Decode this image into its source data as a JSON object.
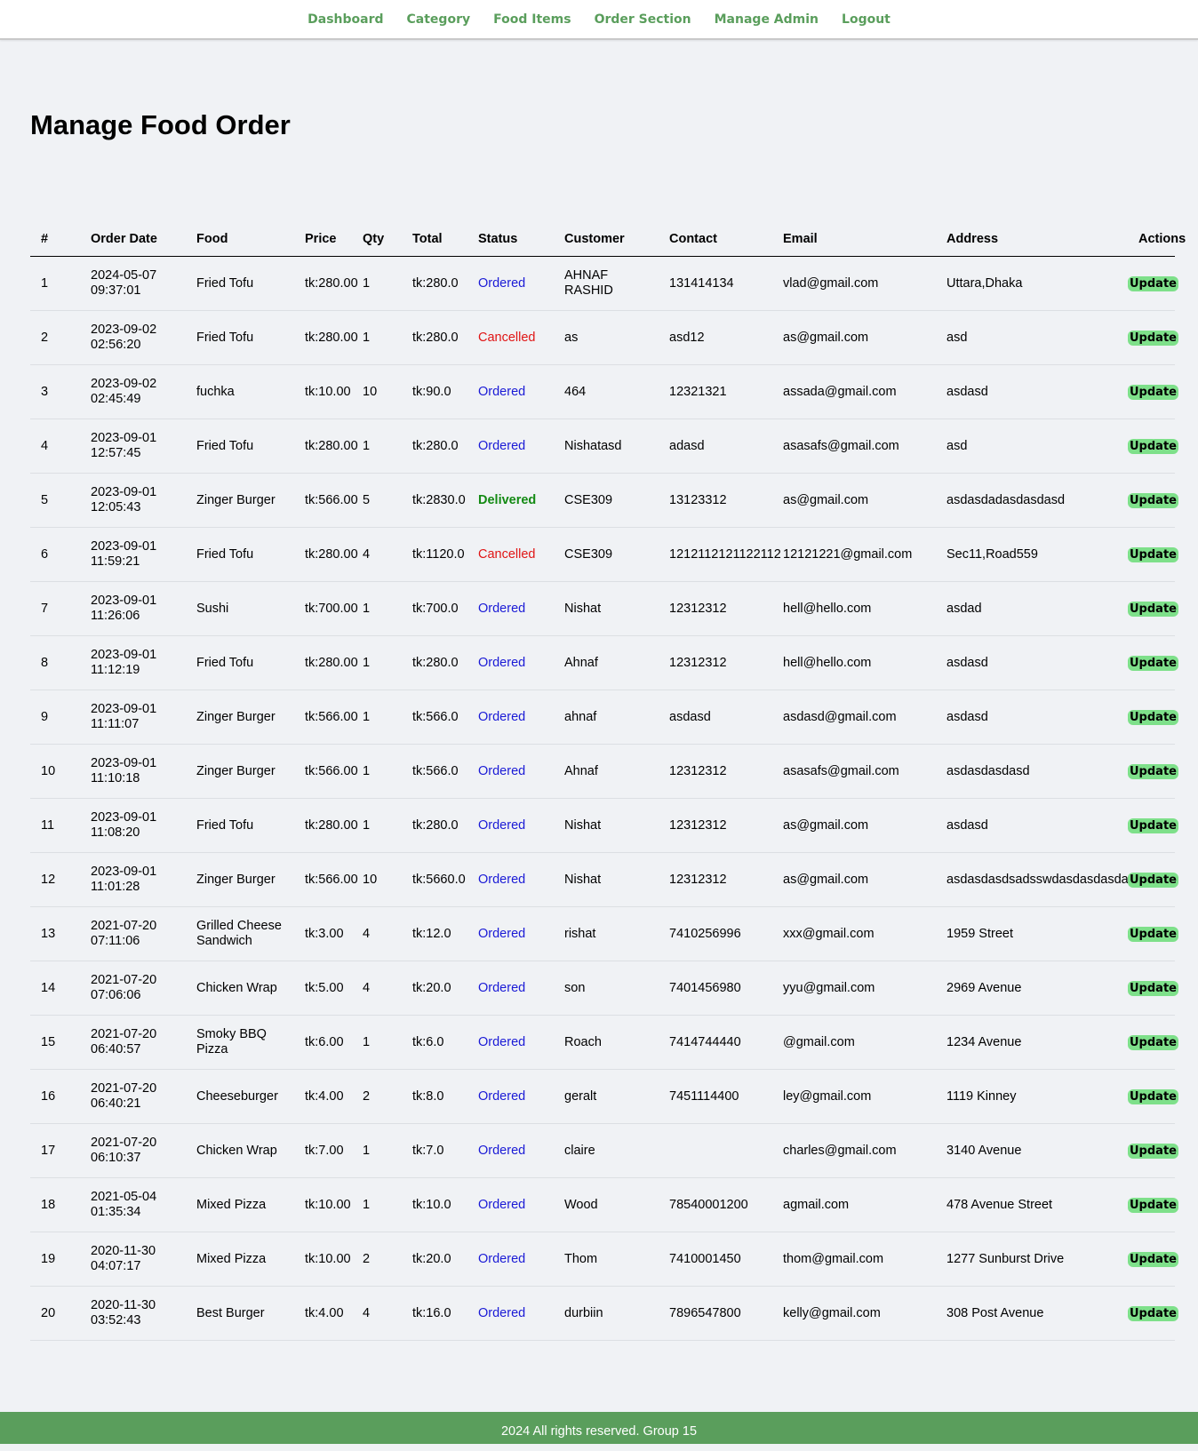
{
  "nav": {
    "items": [
      "Dashboard",
      "Category",
      "Food Items",
      "Order Section",
      "Manage Admin",
      "Logout"
    ]
  },
  "page": {
    "title": "Manage Food Order"
  },
  "table": {
    "headers": [
      "#",
      "Order Date",
      "Food",
      "Price",
      "Qty",
      "Total",
      "Status",
      "Customer",
      "Contact",
      "Email",
      "Address",
      "Actions"
    ],
    "action_label": "Update",
    "rows": [
      {
        "no": "1",
        "date": "2024-05-07",
        "time": "09:37:01",
        "food": "Fried Tofu",
        "price": "tk:280.00",
        "qty": "1",
        "total": "tk:280.0",
        "status": "Ordered",
        "customer": "AHNAF RASHID",
        "contact": "131414134",
        "email": "vlad@gmail.com",
        "address": "Uttara,Dhaka"
      },
      {
        "no": "2",
        "date": "2023-09-02",
        "time": "02:56:20",
        "food": "Fried Tofu",
        "price": "tk:280.00",
        "qty": "1",
        "total": "tk:280.0",
        "status": "Cancelled",
        "customer": "as",
        "contact": "asd12",
        "email": "as@gmail.com",
        "address": "asd"
      },
      {
        "no": "3",
        "date": "2023-09-02",
        "time": "02:45:49",
        "food": "fuchka",
        "price": "tk:10.00",
        "qty": "10",
        "total": "tk:90.0",
        "status": "Ordered",
        "customer": "464",
        "contact": "12321321",
        "email": "assada@gmail.com",
        "address": "asdasd"
      },
      {
        "no": "4",
        "date": "2023-09-01",
        "time": "12:57:45",
        "food": "Fried Tofu",
        "price": "tk:280.00",
        "qty": "1",
        "total": "tk:280.0",
        "status": "Ordered",
        "customer": "Nishatasd",
        "contact": "adasd",
        "email": "asasafs@gmail.com",
        "address": "asd"
      },
      {
        "no": "5",
        "date": "2023-09-01",
        "time": "12:05:43",
        "food": "Zinger Burger",
        "price": "tk:566.00",
        "qty": "5",
        "total": "tk:2830.0",
        "status": "Delivered",
        "customer": "CSE309",
        "contact": "13123312",
        "email": "as@gmail.com",
        "address": "asdasdadasdasdasd"
      },
      {
        "no": "6",
        "date": "2023-09-01",
        "time": "11:59:21",
        "food": "Fried Tofu",
        "price": "tk:280.00",
        "qty": "4",
        "total": "tk:1120.0",
        "status": "Cancelled",
        "customer": "CSE309",
        "contact": "1212112121122112",
        "email": "12121221@gmail.com",
        "address": "Sec11,Road559"
      },
      {
        "no": "7",
        "date": "2023-09-01",
        "time": "11:26:06",
        "food": "Sushi",
        "price": "tk:700.00",
        "qty": "1",
        "total": "tk:700.0",
        "status": "Ordered",
        "customer": "Nishat",
        "contact": "12312312",
        "email": "hell@hello.com",
        "address": "asdad"
      },
      {
        "no": "8",
        "date": "2023-09-01",
        "time": "11:12:19",
        "food": "Fried Tofu",
        "price": "tk:280.00",
        "qty": "1",
        "total": "tk:280.0",
        "status": "Ordered",
        "customer": "Ahnaf",
        "contact": "12312312",
        "email": "hell@hello.com",
        "address": "asdasd"
      },
      {
        "no": "9",
        "date": "2023-09-01",
        "time": "11:11:07",
        "food": "Zinger Burger",
        "price": "tk:566.00",
        "qty": "1",
        "total": "tk:566.0",
        "status": "Ordered",
        "customer": "ahnaf",
        "contact": "asdasd",
        "email": "asdasd@gmail.com",
        "address": "asdasd"
      },
      {
        "no": "10",
        "date": "2023-09-01",
        "time": "11:10:18",
        "food": "Zinger Burger",
        "price": "tk:566.00",
        "qty": "1",
        "total": "tk:566.0",
        "status": "Ordered",
        "customer": "Ahnaf",
        "contact": "12312312",
        "email": "asasafs@gmail.com",
        "address": "asdasdasdasd"
      },
      {
        "no": "11",
        "date": "2023-09-01",
        "time": "11:08:20",
        "food": "Fried Tofu",
        "price": "tk:280.00",
        "qty": "1",
        "total": "tk:280.0",
        "status": "Ordered",
        "customer": "Nishat",
        "contact": "12312312",
        "email": "as@gmail.com",
        "address": "asdasd"
      },
      {
        "no": "12",
        "date": "2023-09-01",
        "time": "11:01:28",
        "food": "Zinger Burger",
        "price": "tk:566.00",
        "qty": "10",
        "total": "tk:5660.0",
        "status": "Ordered",
        "customer": "Nishat",
        "contact": "12312312",
        "email": "as@gmail.com",
        "address": "asdasdasdsadsswdasdasdasdasd"
      },
      {
        "no": "13",
        "date": "2021-07-20",
        "time": "07:11:06",
        "food": "Grilled Cheese Sandwich",
        "price": "tk:3.00",
        "qty": "4",
        "total": "tk:12.0",
        "status": "Ordered",
        "customer": "rishat",
        "contact": "7410256996",
        "email": "xxx@gmail.com",
        "address": "1959 Street"
      },
      {
        "no": "14",
        "date": "2021-07-20",
        "time": "07:06:06",
        "food": "Chicken Wrap",
        "price": "tk:5.00",
        "qty": "4",
        "total": "tk:20.0",
        "status": "Ordered",
        "customer": "son",
        "contact": "7401456980",
        "email": "yyu@gmail.com",
        "address": "2969 Avenue"
      },
      {
        "no": "15",
        "date": "2021-07-20",
        "time": "06:40:57",
        "food": "Smoky BBQ Pizza",
        "price": "tk:6.00",
        "qty": "1",
        "total": "tk:6.0",
        "status": "Ordered",
        "customer": "Roach",
        "contact": "7414744440",
        "email": "@gmail.com",
        "address": "1234 Avenue"
      },
      {
        "no": "16",
        "date": "2021-07-20",
        "time": "06:40:21",
        "food": "Cheeseburger",
        "price": "tk:4.00",
        "qty": "2",
        "total": "tk:8.0",
        "status": "Ordered",
        "customer": "geralt",
        "contact": "7451114400",
        "email": "ley@gmail.com",
        "address": "1119 Kinney"
      },
      {
        "no": "17",
        "date": "2021-07-20",
        "time": "06:10:37",
        "food": "Chicken Wrap",
        "price": "tk:7.00",
        "qty": "1",
        "total": "tk:7.0",
        "status": "Ordered",
        "customer": "claire",
        "contact": "",
        "email": "charles@gmail.com",
        "address": "3140 Avenue"
      },
      {
        "no": "18",
        "date": "2021-05-04",
        "time": "01:35:34",
        "food": "Mixed Pizza",
        "price": "tk:10.00",
        "qty": "1",
        "total": "tk:10.0",
        "status": "Ordered",
        "customer": "Wood",
        "contact": "78540001200",
        "email": "agmail.com",
        "address": "478 Avenue Street"
      },
      {
        "no": "19",
        "date": "2020-11-30",
        "time": "04:07:17",
        "food": "Mixed Pizza",
        "price": "tk:10.00",
        "qty": "2",
        "total": "tk:20.0",
        "status": "Ordered",
        "customer": "Thom",
        "contact": "7410001450",
        "email": "thom@gmail.com",
        "address": "1277 Sunburst Drive"
      },
      {
        "no": "20",
        "date": "2020-11-30",
        "time": "03:52:43",
        "food": "Best Burger",
        "price": "tk:4.00",
        "qty": "4",
        "total": "tk:16.0",
        "status": "Ordered",
        "customer": "durbiin",
        "contact": "7896547800",
        "email": "kelly@gmail.com",
        "address": "308 Post Avenue"
      }
    ]
  },
  "footer": {
    "text": "2024 All rights reserved. Group 15"
  },
  "colors": {
    "brand_green": "#5a9e5c",
    "ordered": "#1a1ad6",
    "cancelled": "#e01515",
    "delivered": "#138a13",
    "update_button": "#7ee08a"
  }
}
